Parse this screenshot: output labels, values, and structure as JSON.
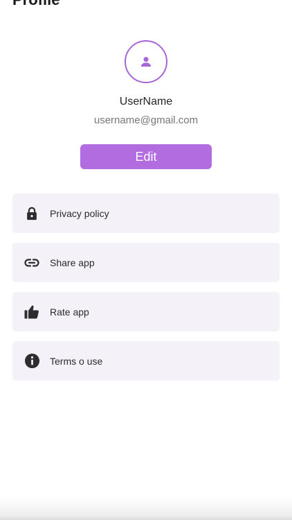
{
  "header": {
    "title": "Profile"
  },
  "profile": {
    "avatar_icon": "user-icon",
    "username": "UserName",
    "email": "username@gmail.com",
    "edit_label": "Edit"
  },
  "menu": {
    "items": [
      {
        "label": "Privacy policy",
        "icon": "lock-icon"
      },
      {
        "label": "Share app",
        "icon": "link-icon"
      },
      {
        "label": "Rate app",
        "icon": "thumbs-up-icon"
      },
      {
        "label": "Terms o use",
        "icon": "info-icon"
      }
    ]
  },
  "colors": {
    "accent": "#b36be0",
    "avatar_border": "#a765d8",
    "card_background": "#f5f1f9",
    "icon": "#2d2d2d"
  }
}
